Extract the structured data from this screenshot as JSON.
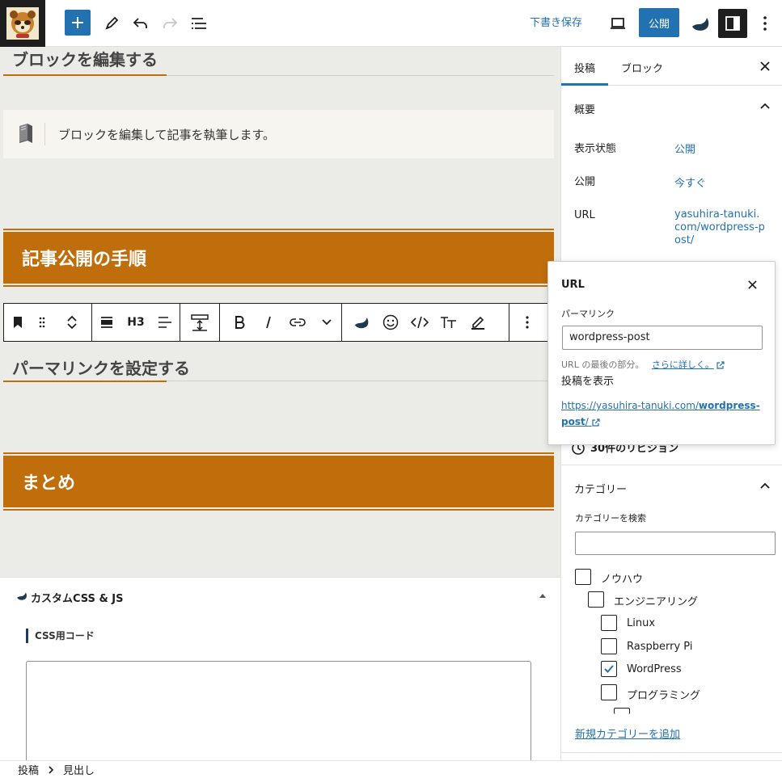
{
  "topbar": {
    "save_draft": "下書き保存",
    "publish": "公開"
  },
  "canvas": {
    "heading1": "ブロックを編集する",
    "info_text": "ブロックを編集して記事を執筆します。",
    "h2_1": "記事公開の手順",
    "toolbar_level": "H3",
    "heading2": "パーマリンクを設定する",
    "h2_2": "まとめ"
  },
  "css_panel": {
    "title": "カスタムCSS & JS",
    "label": "CSS用コード"
  },
  "breadcrumb": {
    "items": [
      "投稿",
      "見出し"
    ]
  },
  "sidebar": {
    "tabs": [
      "投稿",
      "ブロック"
    ],
    "summary_title": "概要",
    "rows": [
      {
        "label": "表示状態",
        "value": "公開"
      },
      {
        "label": "公開",
        "value": "今すぐ"
      },
      {
        "label": "URL",
        "value": "yasuhira-tanuki.com/wordpress-post/"
      }
    ],
    "revisions": "30件のリビジョン",
    "categories_title": "カテゴリー",
    "category_search_label": "カテゴリーを検索",
    "categories": [
      {
        "label": "ノウハウ",
        "checked": false
      },
      {
        "label": "エンジニアリング",
        "checked": false
      },
      {
        "label": "Linux",
        "checked": false
      },
      {
        "label": "Raspberry Pi",
        "checked": false
      },
      {
        "label": "WordPress",
        "checked": true
      },
      {
        "label": "プログラミング",
        "checked": false
      }
    ],
    "add_category": "新規カテゴリーを追加"
  },
  "url_popover": {
    "title": "URL",
    "permalink_label": "パーマリンク",
    "permalink_value": "wordpress-post",
    "help_prefix": "URL の最後の部分。",
    "help_link": "さらに詳しく。",
    "view_post_label": "投稿を表示",
    "full_url_base": "https://yasuhira-tanuki.com/",
    "full_url_slug": "wordpress-post",
    "full_url_suffix": "/"
  },
  "colors": {
    "accent": "#2271b1",
    "heading_band": "#c06e0c",
    "canvas_bg": "#ebece8"
  }
}
